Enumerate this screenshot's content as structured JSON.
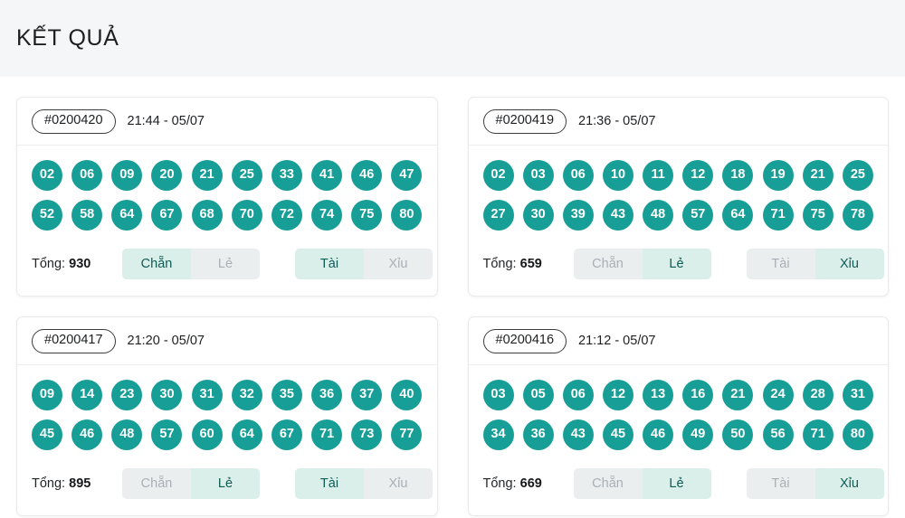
{
  "header": {
    "title": "KẾT QUẢ"
  },
  "labels": {
    "total_prefix": "Tổng:",
    "even": "Chẵn",
    "odd": "Lẻ",
    "big": "Tài",
    "small": "Xỉu"
  },
  "colors": {
    "ball": "#179e96",
    "toggle_active_bg": "#daeeea",
    "toggle_active_text": "#0f5c55",
    "toggle_inactive_bg": "#ebeeef",
    "toggle_inactive_text": "#a9b0b5",
    "header_band": "#f5f6f7",
    "card_border": "#e9eaec"
  },
  "results": [
    {
      "draw_id": "#0200420",
      "time": "21:44 - 05/07",
      "numbers_row1": [
        "02",
        "06",
        "09",
        "20",
        "21",
        "25",
        "33",
        "41",
        "46",
        "47"
      ],
      "numbers_row2": [
        "52",
        "58",
        "64",
        "67",
        "68",
        "70",
        "72",
        "74",
        "75",
        "80"
      ],
      "total": "930",
      "total_text": "Tổng: 930",
      "parity_active": "Chẵn",
      "size_active": "Tài"
    },
    {
      "draw_id": "#0200419",
      "time": "21:36 - 05/07",
      "numbers_row1": [
        "02",
        "03",
        "06",
        "10",
        "11",
        "12",
        "18",
        "19",
        "21",
        "25"
      ],
      "numbers_row2": [
        "27",
        "30",
        "39",
        "43",
        "48",
        "57",
        "64",
        "71",
        "75",
        "78"
      ],
      "total": "659",
      "total_text": "Tổng: 659",
      "parity_active": "Lẻ",
      "size_active": "Xỉu"
    },
    {
      "draw_id": "#0200417",
      "time": "21:20 - 05/07",
      "numbers_row1": [
        "09",
        "14",
        "23",
        "30",
        "31",
        "32",
        "35",
        "36",
        "37",
        "40"
      ],
      "numbers_row2": [
        "45",
        "46",
        "48",
        "57",
        "60",
        "64",
        "67",
        "71",
        "73",
        "77"
      ],
      "total": "895",
      "total_text": "Tổng: 895",
      "parity_active": "Lẻ",
      "size_active": "Tài"
    },
    {
      "draw_id": "#0200416",
      "time": "21:12 - 05/07",
      "numbers_row1": [
        "03",
        "05",
        "06",
        "12",
        "13",
        "16",
        "21",
        "24",
        "28",
        "31"
      ],
      "numbers_row2": [
        "34",
        "36",
        "43",
        "45",
        "46",
        "49",
        "50",
        "56",
        "71",
        "80"
      ],
      "total": "669",
      "total_text": "Tổng: 669",
      "parity_active": "Lẻ",
      "size_active": "Xỉu"
    }
  ]
}
